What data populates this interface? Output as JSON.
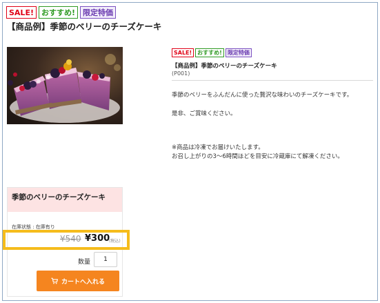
{
  "badges": {
    "sale": "SALE!",
    "recommend": "おすすめ!",
    "limited": "限定特価"
  },
  "product": {
    "name_heading": "【商品例】季節のベリーのチーズケーキ",
    "detail_title": "【商品例】季節のベリーのチーズケーキ",
    "code": "(P001)",
    "description": [
      "季節のベリーをふんだんに使った贅沢な味わいのチーズケーキです。",
      "是非、ご賞味ください。"
    ],
    "notes": [
      "※商品は冷凍でお届けいたします。",
      "お召し上がりの3〜6時間ほどを目安に冷蔵庫にて解凍ください。"
    ],
    "image_alt": "berry-cheesecake-photo"
  },
  "purchase": {
    "card_title": "季節のベリーのチーズケーキ",
    "stock_status": "在庫状態 : 在庫有り",
    "old_price": "¥540",
    "new_price": "¥300",
    "tax_note": "(税込)",
    "quantity_label": "数量",
    "quantity_value": "1",
    "cart_button_label": "カートへ入れる",
    "cart_icon": "cart-icon"
  },
  "colors": {
    "sale": "#e00016",
    "recommend": "#2e9a22",
    "limited": "#6a3bb0",
    "card_header": "#fde3e3",
    "highlight": "#f5bc1c",
    "cart_button": "#f5851f"
  }
}
